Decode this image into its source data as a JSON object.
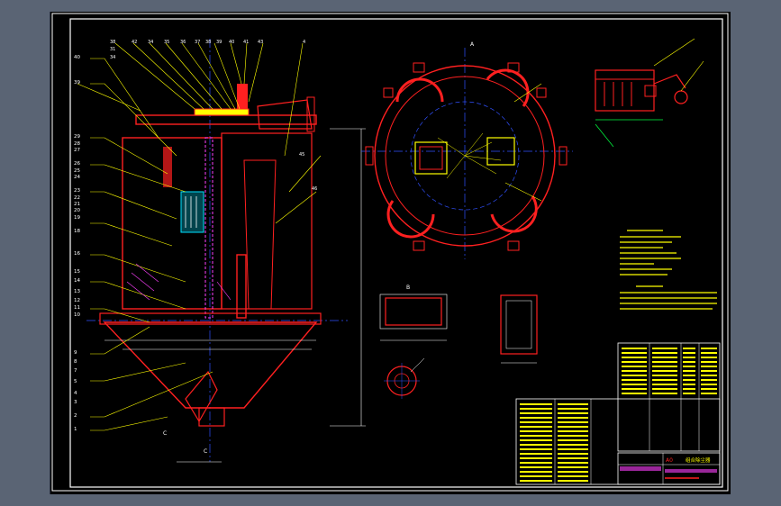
{
  "colors": {
    "background": "#5a6474",
    "canvas": "#000000",
    "frame": "#ffffff",
    "outline": "#ff2020",
    "leader": "#ffff00",
    "centerline": "#3050ff",
    "hatch": "#ff40ff",
    "dimension": "#ffffff",
    "cyan": "#00e0ff",
    "green": "#00ff40"
  },
  "views": {
    "section_label_a": "A",
    "section_label_b": "B",
    "section_label_c": "C"
  },
  "part_numbers_left": [
    "38",
    "37",
    "36",
    "35",
    "34",
    "33",
    "32",
    "31",
    "30",
    "29",
    "28",
    "27",
    "26",
    "25",
    "24",
    "23",
    "22",
    "21",
    "20",
    "19",
    "18",
    "17",
    "16",
    "15",
    "14",
    "13",
    "12",
    "11",
    "10",
    "9",
    "8",
    "7",
    "6",
    "5",
    "4",
    "3",
    "2",
    "1"
  ],
  "part_numbers_top": [
    "38",
    "39",
    "40",
    "41",
    "42",
    "43",
    "44",
    "45",
    "46",
    "47",
    "48"
  ],
  "title_block": {
    "scale_label": "A3",
    "drawing_title": "组合除尘器",
    "drawing_number": "A0"
  }
}
